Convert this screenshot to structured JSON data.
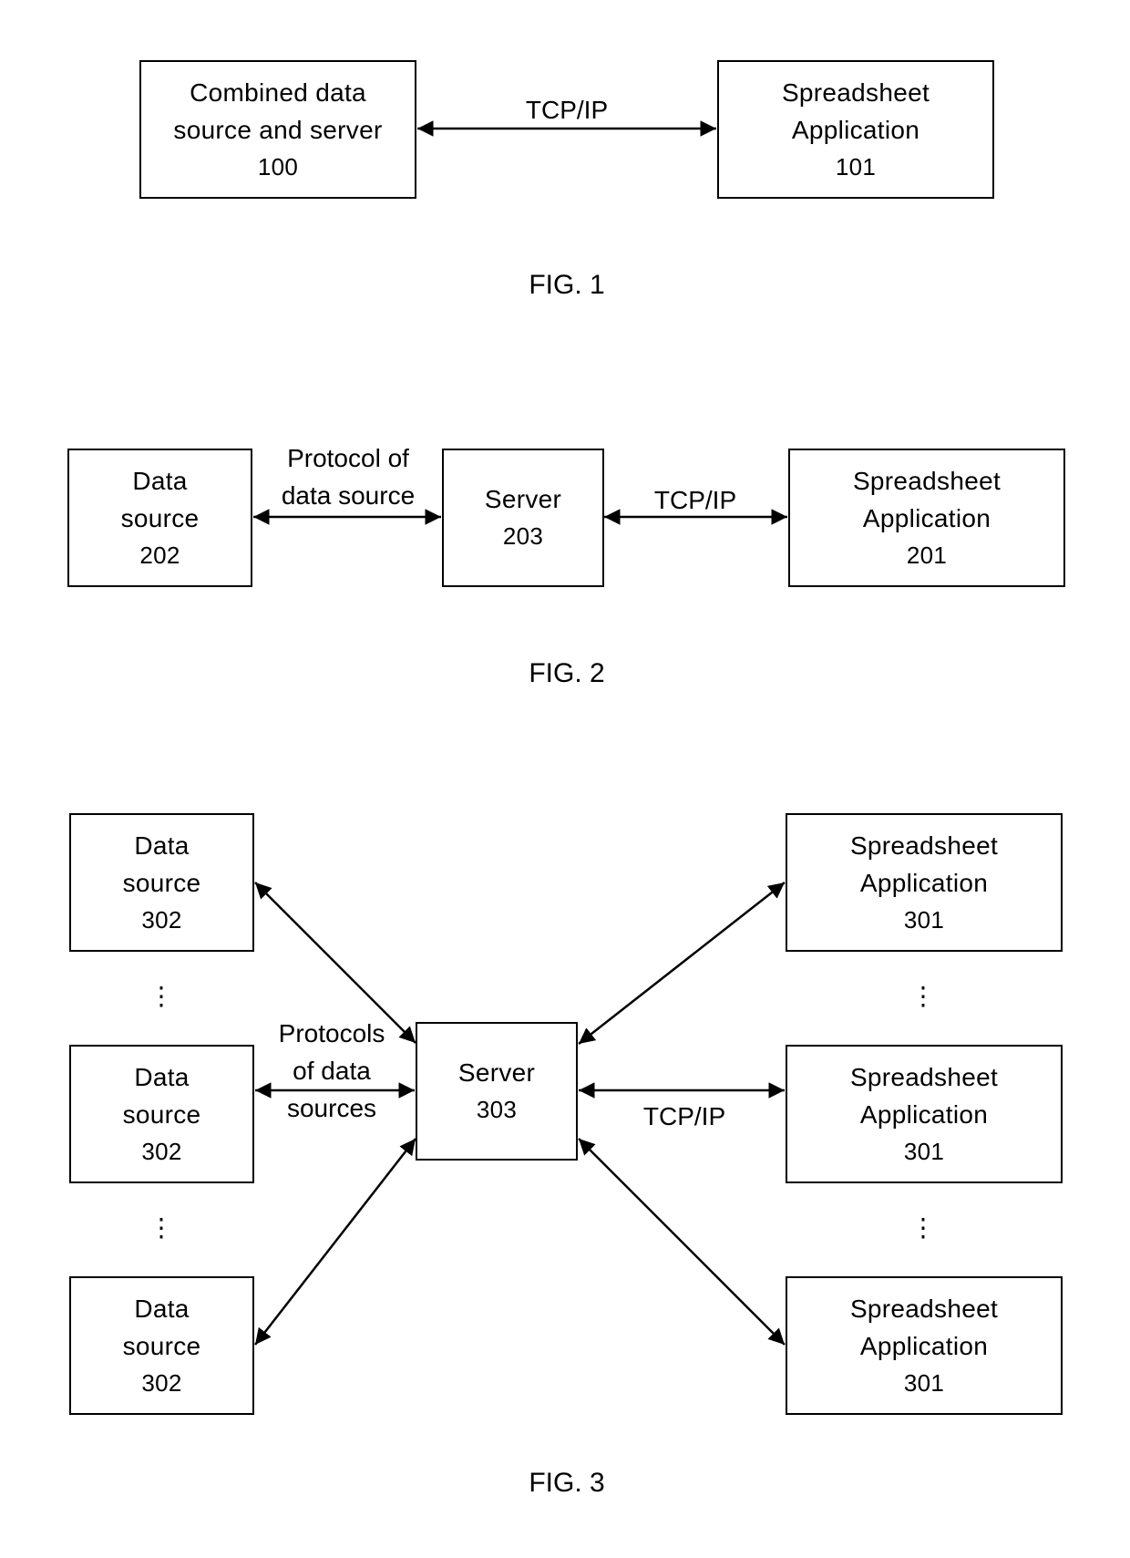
{
  "fig1": {
    "caption": "FIG. 1",
    "left_box": {
      "line1": "Combined data",
      "line2": "source and server",
      "ref": "100"
    },
    "right_box": {
      "line1": "Spreadsheet",
      "line2": "Application",
      "ref": "101"
    },
    "link_label": "TCP/IP"
  },
  "fig2": {
    "caption": "FIG. 2",
    "data_source": {
      "line1": "Data",
      "line2": "source",
      "ref": "202"
    },
    "server": {
      "line1": "Server",
      "ref": "203"
    },
    "spreadsheet": {
      "line1": "Spreadsheet",
      "line2": "Application",
      "ref": "201"
    },
    "left_link": {
      "line1": "Protocol of",
      "line2": "data source"
    },
    "right_link": "TCP/IP"
  },
  "fig3": {
    "caption": "FIG. 3",
    "data_sources": [
      {
        "line1": "Data",
        "line2": "source",
        "ref": "302"
      },
      {
        "line1": "Data",
        "line2": "source",
        "ref": "302"
      },
      {
        "line1": "Data",
        "line2": "source",
        "ref": "302"
      }
    ],
    "server": {
      "line1": "Server",
      "ref": "303"
    },
    "spreadsheets": [
      {
        "line1": "Spreadsheet",
        "line2": "Application",
        "ref": "301"
      },
      {
        "line1": "Spreadsheet",
        "line2": "Application",
        "ref": "301"
      },
      {
        "line1": "Spreadsheet",
        "line2": "Application",
        "ref": "301"
      }
    ],
    "left_link": {
      "line1": "Protocols",
      "line2": "of data",
      "line3": "sources"
    },
    "right_link": "TCP/IP",
    "ellipsis": "⋮"
  }
}
